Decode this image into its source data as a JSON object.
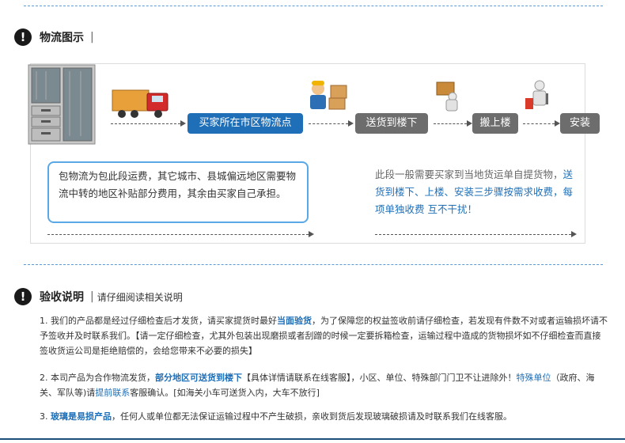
{
  "logistics": {
    "title": "物流图示",
    "bar": "|",
    "steps": {
      "s1": "买家所在市区物流点",
      "s2": "送货到楼下",
      "s3": "搬上楼",
      "s4": "安装"
    },
    "left_note": "包物流为包此段运费，其它城市、县城偏远地区需要物流中转的地区补贴部分费用，其余由买家自己承担。",
    "right_note": {
      "part1": "此段一般需要买家到当地货运单自提货物，",
      "part2": "送货到楼下、上楼、安装三步骤按需求收费，每项单独收费 互不干扰！"
    }
  },
  "inspection": {
    "title": "验收说明",
    "bar": "|",
    "subtitle": "请仔细阅读相关说明",
    "p1": {
      "a": "1. 我们的产品都是经过仔细检查后才发货，请买家提货时最好",
      "hl": "当面验货",
      "b": "，为了保障您的权益签收前请仔细检查，若发现有件数不对或者运输损坏请不予签收并及时联系我们。【请一定仔细检查，尤其外包装出现磨损或者刮蹭的时候一定要拆箱检查，运输过程中造成的货物损坏如不仔细检查而直接签收货运公司是拒绝赔偿的，会给您带来不必要的损失】"
    },
    "p2": {
      "a": "2. 本司产品为合作物流发货，",
      "hl": "部分地区可送货到楼下",
      "b": "【具体详情请联系在线客服】，小区、单位、特殊部门门卫不让进除外！",
      "hl2": "特殊单位",
      "c": "（政府、海关、军队等)请",
      "hl3": "提前联系",
      "d": "客服确认。[如海关小车可送货入内，大车不放行]"
    },
    "p3": {
      "a": "3. ",
      "hl": "玻璃是易损产品",
      "b": "，任何人或单位都无法保证运输过程中不产生破损，亲收到货后发现玻璃破损请及时联系我们在线客服。"
    }
  },
  "colors": {
    "accent": "#1e6fb8",
    "step_gray": "#6d6d6d",
    "note_border": "#5aa9e6"
  },
  "icons": [
    "exclamation-icon",
    "cabinet-image",
    "truck-image",
    "workers-image",
    "carry-worker-image",
    "installer-image"
  ]
}
